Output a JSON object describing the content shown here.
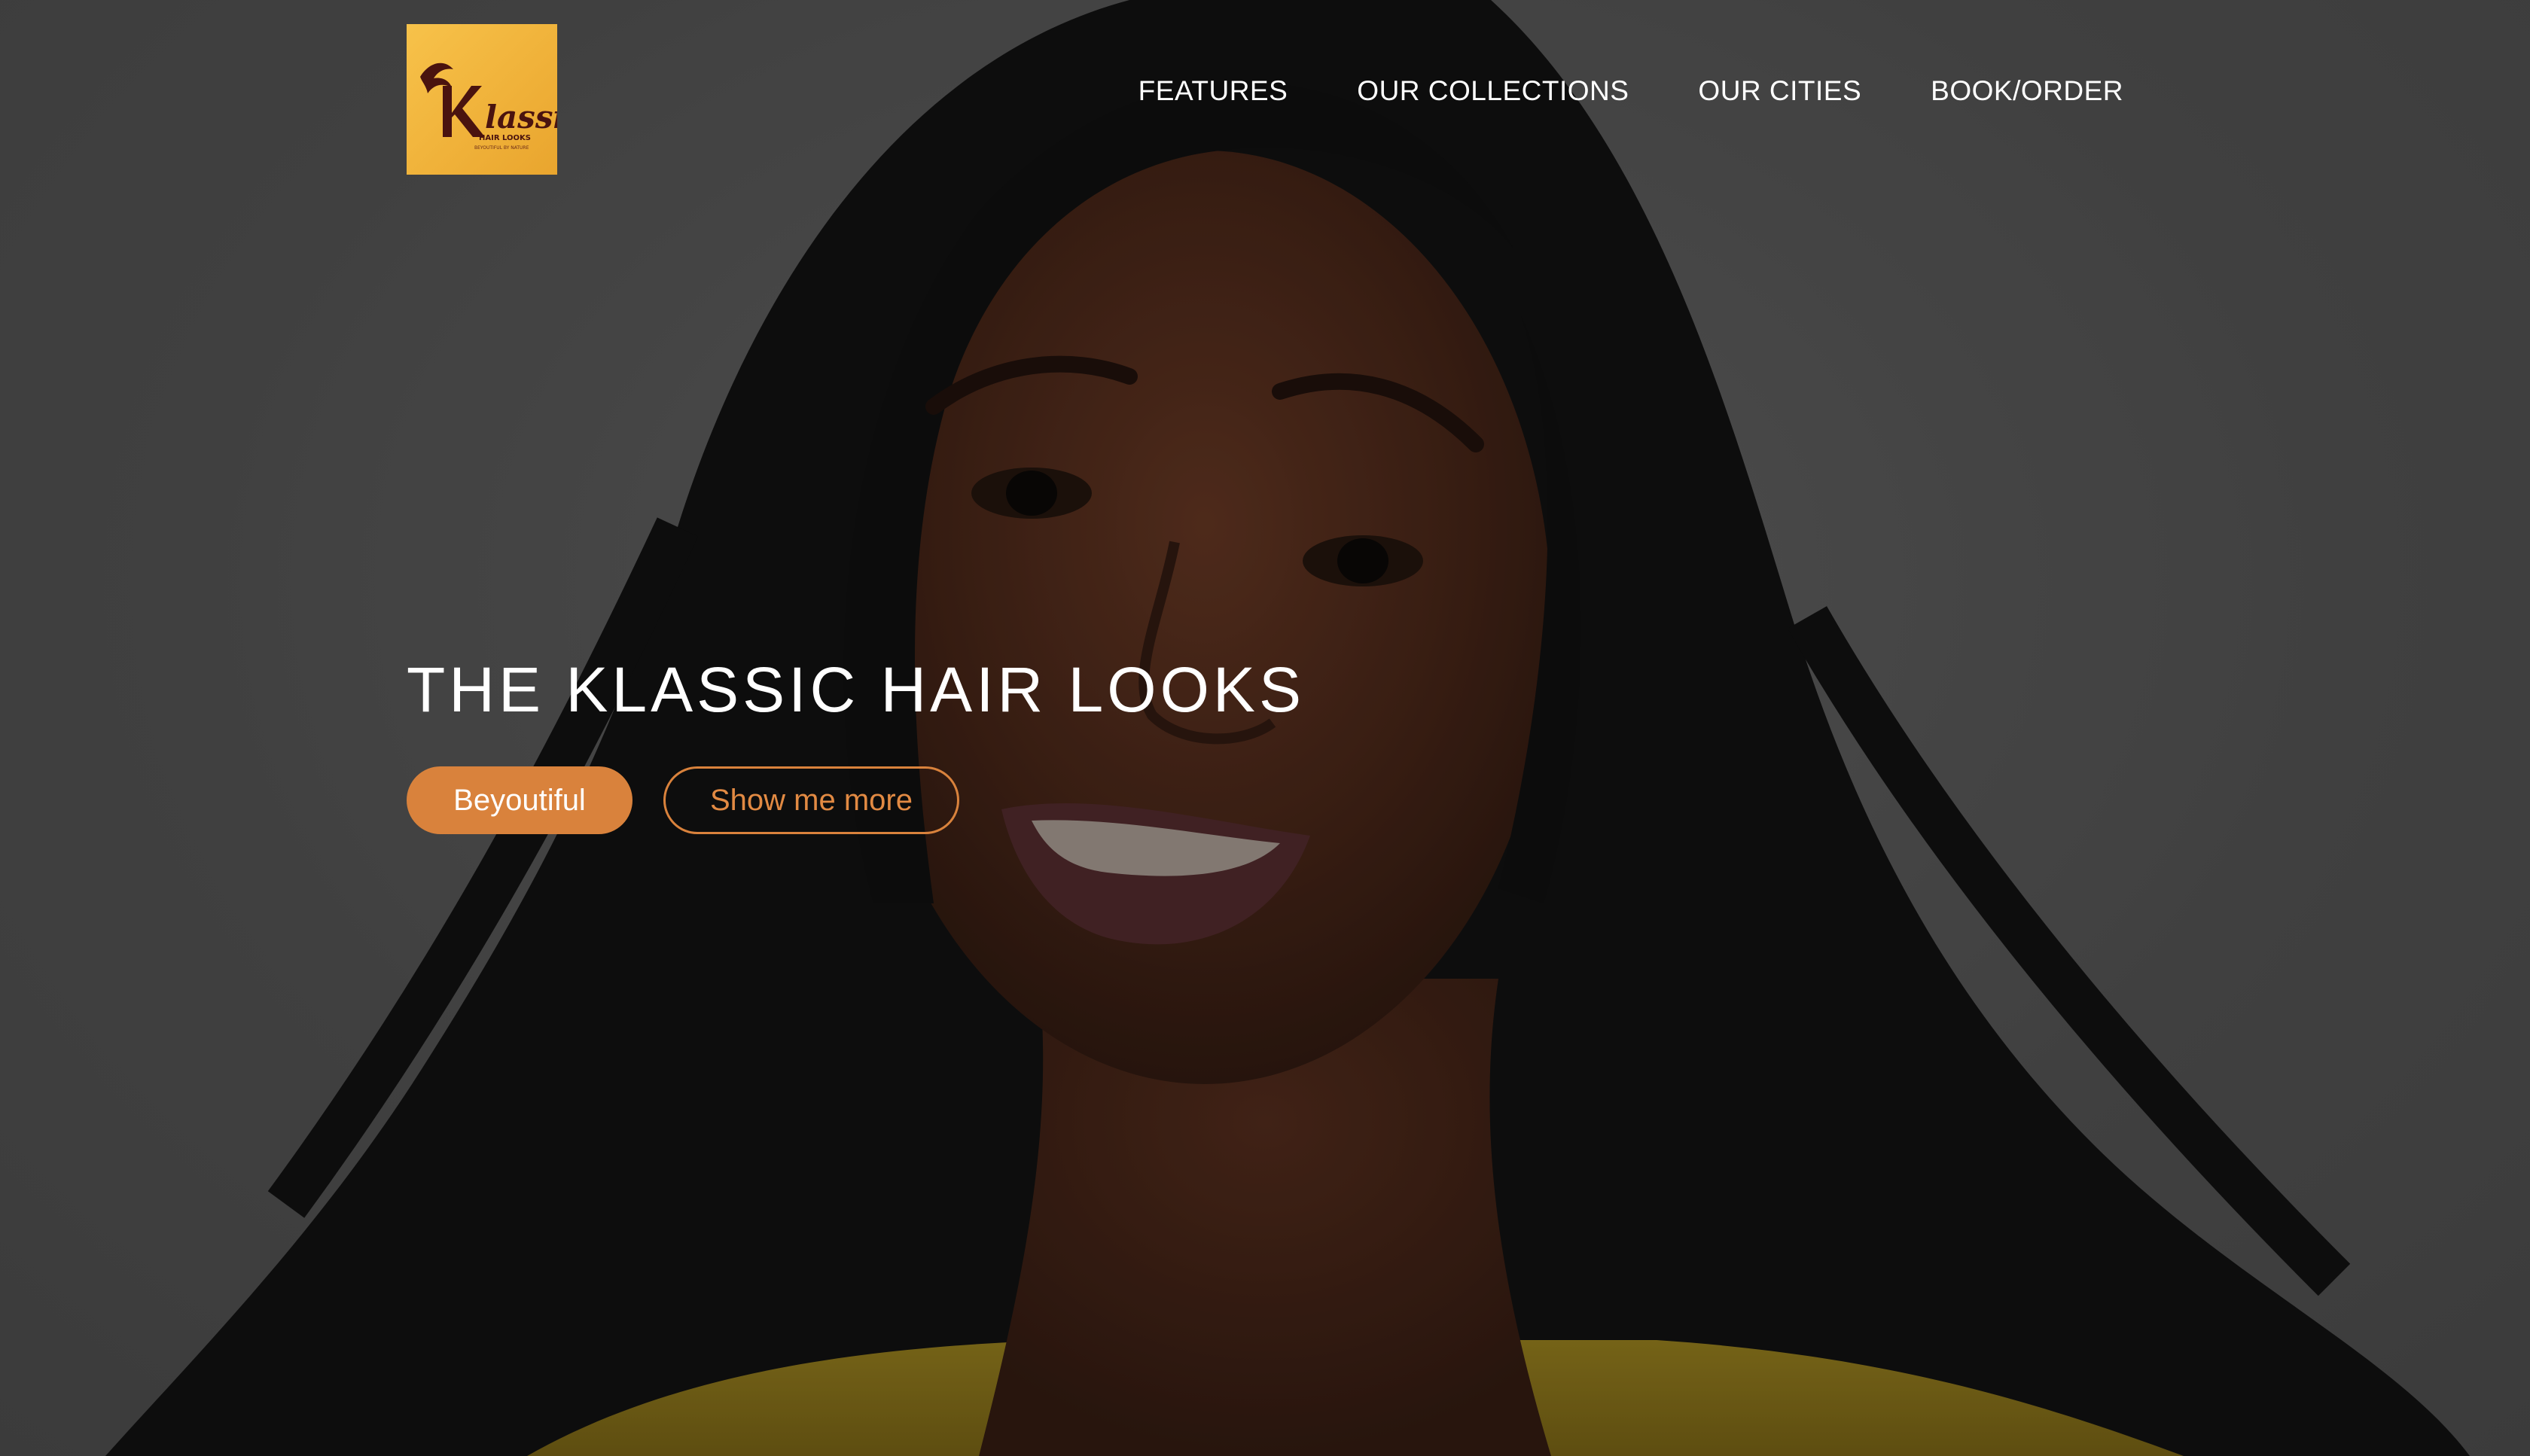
{
  "header": {
    "logo": {
      "brand_text": "Klassic",
      "sub_text": "HAIR LOOKS",
      "tagline": "BEYOUTIFUL BY NATURE",
      "background": "#f4b942",
      "ink": "#5a1a14"
    },
    "nav": [
      {
        "label": "FEATURES"
      },
      {
        "label": "OUR COLLECTIONS"
      },
      {
        "label": "OUR CITIES"
      },
      {
        "label": "BOOK/ORDER"
      }
    ]
  },
  "hero": {
    "title": "THE KLASSIC HAIR LOOKS",
    "primary_button": "Beyoutiful",
    "secondary_button": "Show me more",
    "accent_color": "#d9823c",
    "image": "portrait of smiling woman with long dark hair"
  }
}
